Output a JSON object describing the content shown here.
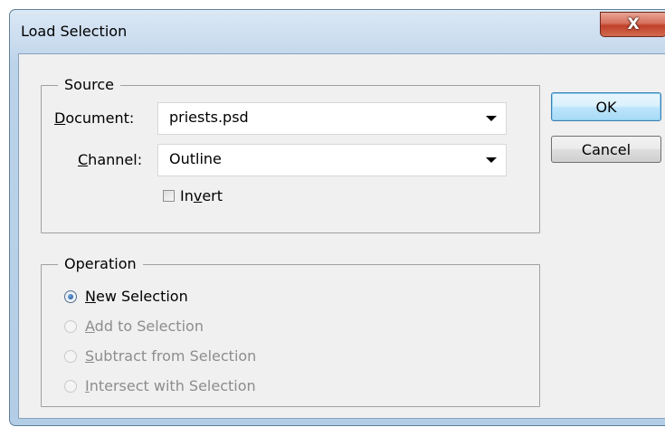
{
  "window": {
    "title": "Load Selection",
    "close_glyph": "X"
  },
  "source": {
    "legend": "Source",
    "document_label_hotkey": "D",
    "document_label_rest": "ocument:",
    "document_value": "priests.psd",
    "channel_label_hotkey": "C",
    "channel_label_rest": "hannel:",
    "channel_value": "Outline",
    "invert_label_pre": "In",
    "invert_label_hotkey": "v",
    "invert_label_post": "ert",
    "invert_checked": false
  },
  "operation": {
    "legend": "Operation",
    "options": [
      {
        "hotkey": "N",
        "rest": "ew Selection",
        "checked": true,
        "enabled": true
      },
      {
        "hotkey": "A",
        "rest": "dd to Selection",
        "checked": false,
        "enabled": false
      },
      {
        "hotkey": "S",
        "rest": "ubtract from Selection",
        "checked": false,
        "enabled": false
      },
      {
        "hotkey": "I",
        "rest": "ntersect with Selection",
        "checked": false,
        "enabled": false
      }
    ]
  },
  "buttons": {
    "ok": "OK",
    "cancel": "Cancel"
  },
  "icons": {
    "close": "close-icon",
    "dropdown": "chevron-down-icon",
    "checkbox": "checkbox-icon",
    "radio": "radio-icon"
  }
}
